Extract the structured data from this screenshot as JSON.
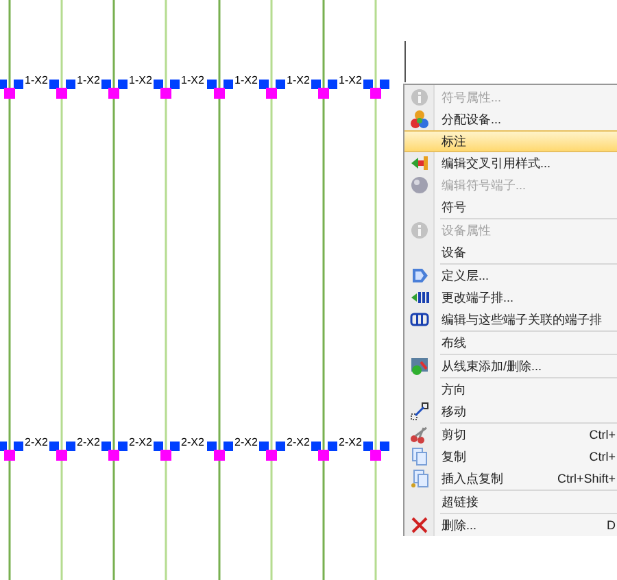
{
  "canvas": {
    "top_labels": [
      "1-X2",
      "1-X2",
      "1-X2",
      "1-X2",
      "1-X2",
      "1-X2",
      "1-X2"
    ],
    "bottom_labels": [
      "2-X2",
      "2-X2",
      "2-X2",
      "2-X2",
      "2-X2",
      "2-X2",
      "2-X2"
    ]
  },
  "context_menu": [
    {
      "kind": "item",
      "label": "符号属性...",
      "disabled": true,
      "selected": false
    },
    {
      "kind": "item",
      "label": "分配设备...",
      "disabled": false,
      "selected": false
    },
    {
      "kind": "item",
      "label": "标注",
      "disabled": false,
      "selected": true
    },
    {
      "kind": "item",
      "label": "编辑交叉引用样式...",
      "disabled": false,
      "selected": false
    },
    {
      "kind": "item",
      "label": "编辑符号端子...",
      "disabled": true,
      "selected": false
    },
    {
      "kind": "item",
      "label": "符号",
      "disabled": false,
      "selected": false
    },
    {
      "kind": "separator"
    },
    {
      "kind": "item",
      "label": "设备属性",
      "disabled": true,
      "selected": false
    },
    {
      "kind": "item",
      "label": "设备",
      "disabled": false,
      "selected": false
    },
    {
      "kind": "separator"
    },
    {
      "kind": "item",
      "label": "定义层...",
      "disabled": false,
      "selected": false
    },
    {
      "kind": "item",
      "label": "更改端子排...",
      "disabled": false,
      "selected": false
    },
    {
      "kind": "item",
      "label": "编辑与这些端子关联的端子排",
      "disabled": false,
      "selected": false
    },
    {
      "kind": "separator"
    },
    {
      "kind": "item",
      "label": "布线",
      "disabled": false,
      "selected": false
    },
    {
      "kind": "separator"
    },
    {
      "kind": "item",
      "label": "从线束添加/删除...",
      "disabled": false,
      "selected": false
    },
    {
      "kind": "separator"
    },
    {
      "kind": "item",
      "label": "方向",
      "disabled": false,
      "selected": false
    },
    {
      "kind": "item",
      "label": "移动",
      "disabled": false,
      "selected": false
    },
    {
      "kind": "separator"
    },
    {
      "kind": "item",
      "label": "剪切",
      "shortcut": "Ctrl+",
      "disabled": false,
      "selected": false
    },
    {
      "kind": "item",
      "label": "复制",
      "shortcut": "Ctrl+",
      "disabled": false,
      "selected": false
    },
    {
      "kind": "item",
      "label": "插入点复制",
      "shortcut": "Ctrl+Shift+",
      "disabled": false,
      "selected": false
    },
    {
      "kind": "separator"
    },
    {
      "kind": "item",
      "label": "超链接",
      "disabled": false,
      "selected": false
    },
    {
      "kind": "separator"
    },
    {
      "kind": "item",
      "label": "删除...",
      "shortcut": "D",
      "disabled": false,
      "selected": false
    }
  ]
}
